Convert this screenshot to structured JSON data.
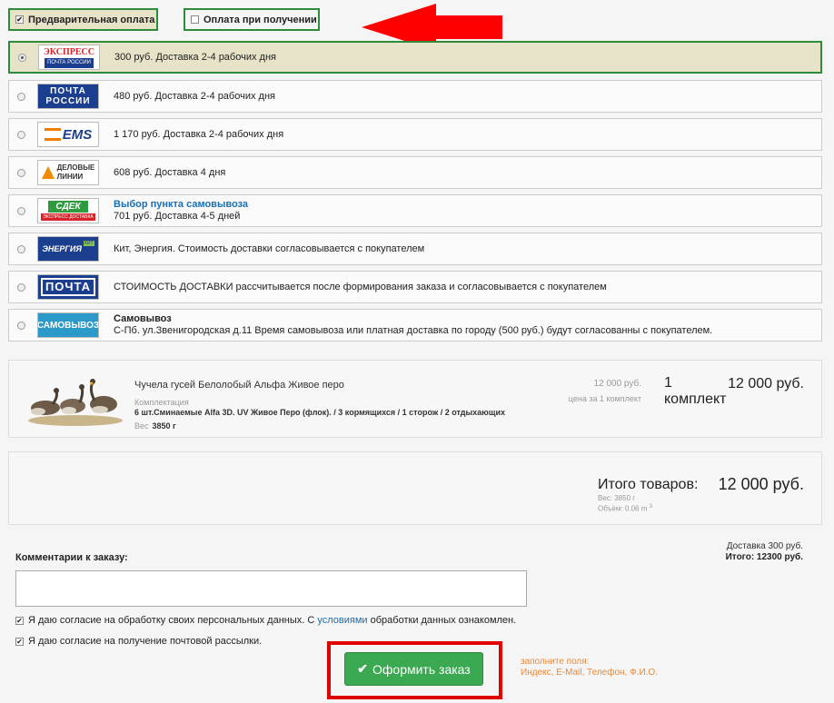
{
  "payment": {
    "prepay_label": "Предварительная оплата",
    "cod_label": "Оплата при получении"
  },
  "colors": {
    "accent_green": "#2e8b3a",
    "highlight_bg": "#e6e3c8",
    "alert_red": "#e00000",
    "button_green": "#3ba852",
    "hint_orange": "#e88a3a",
    "link_blue": "#1a6fb0"
  },
  "shipping": [
    {
      "logo_line1": "ЭКСПРЕСС",
      "logo_line2": "ПОЧТА РОССИИ",
      "text": "300 руб. Доставка 2-4 рабочих дня"
    },
    {
      "logo_line1": "ПОЧТА",
      "logo_line2": "РОССИИ",
      "text": "480 руб. Доставка 2-4 рабочих дня"
    },
    {
      "logo_line1": "EMS",
      "text": "1 170 руб. Доставка 2-4 рабочих дня"
    },
    {
      "logo_line1": "ДЕЛОВЫЕ",
      "logo_line2": "ЛИНИИ",
      "text": "608 руб. Доставка 4 дня"
    },
    {
      "logo_line1": "СДЕК",
      "logo_line2": "ЭКСПРЕСС ДОСТАВКА",
      "link": "Выбор пункта самовывоза",
      "text": "701 руб. Доставка 4-5 дней"
    },
    {
      "logo_line1": "ЭНЕРГИЯ",
      "logo_line2": "КИТ",
      "text": "Кит, Энергия. Стоимость доставки согласовывается с покупателем"
    },
    {
      "logo_line1": "ПОЧТА",
      "text": "СТОИМОСТЬ ДОСТАВКИ рассчитывается после формирования заказа и согласовывается с покупателем"
    },
    {
      "logo_line1": "САМОВЫВОЗ",
      "title": "Самовывоз",
      "text": "С-Пб. ул.Звенигородская д.11 Время самовывоза или платная доставка по городу (500 руб.) будут согласованны с покупателем."
    }
  ],
  "cart": {
    "product_name": "Чучела гусей Белолобый Альфа Живое перо",
    "komp_label": "Комплектация",
    "komp_value": "6 шт.Сминаемые Alfa 3D. UV Живое Перо (флок). / 3 кормящихся / 1 сторож / 2 отдыхающих",
    "weight_label": "Вес",
    "weight_value": "3850 г",
    "unit_price": "12 000 руб.",
    "unit_price_label": "цена за 1 комплект",
    "qty_line1": "1",
    "qty_line2": "комплект",
    "line_total": "12 000 руб."
  },
  "totals": {
    "label": "Итого товаров:",
    "value": "12 000 руб.",
    "weight": "Вес: 3850 г",
    "volume": "Объём: 0.06 m",
    "volume_sup": "3",
    "delivery": "Доставка 300 руб.",
    "grand": "Итого: 12300 руб."
  },
  "comments": {
    "label": "Комментарии к заказу:",
    "value": ""
  },
  "agreements": {
    "personal_pre": "Я даю согласие на обработку своих персональных данных. С ",
    "personal_link": "условиями",
    "personal_post": " обработки данных ознакомлен.",
    "mailing": "Я даю согласие на получение почтовой рассылки."
  },
  "submit_label": "Оформить заказ",
  "hint": {
    "line1": "заполните поля:",
    "line2": "Индекс, E-Mail, Телефон, Ф.И.О."
  }
}
